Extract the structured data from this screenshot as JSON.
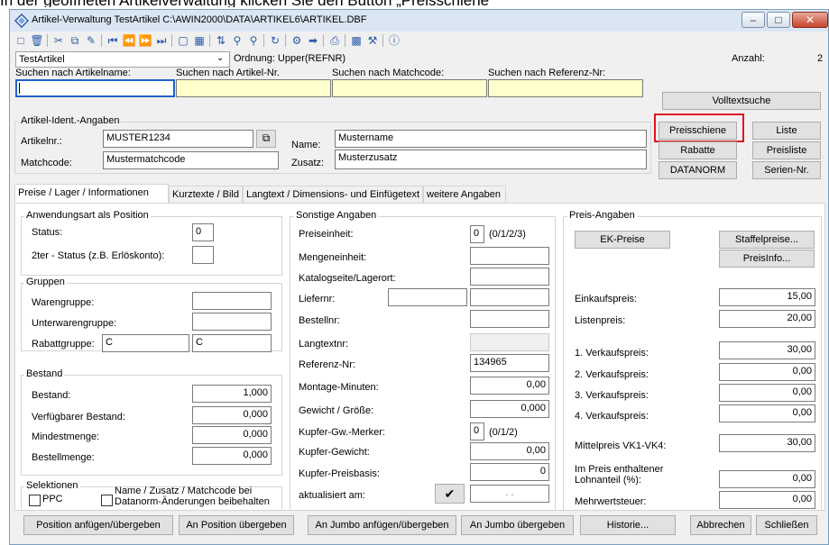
{
  "caption": "In der geöffneten Artikelverwaltung klicken Sie den Button „Preisschiene“",
  "window": {
    "title": "Artikel-Verwaltung   TestArtikel   C:\\AWIN2000\\DATA\\ARTIKEL6\\ARTIKEL.DBF",
    "minimize": "–",
    "maximize": "□",
    "close": "✕"
  },
  "toolbar_icons": [
    "new-doc-icon",
    "delete-icon",
    "cut-icon",
    "copy-icon",
    "paste-icon",
    "first-record-icon",
    "prev-page-icon",
    "next-page-icon",
    "last-record-icon",
    "form-view-icon",
    "table-view-icon",
    "sort-icon",
    "search-icon",
    "search-next-icon",
    "refresh-icon",
    "filter-icon",
    "goto-icon",
    "print-icon",
    "report-icon",
    "settings-icon",
    "info-icon"
  ],
  "search": {
    "table_name": "TestArtikel",
    "ordnung": "Ordnung: Upper(REFNR)",
    "anzahl_label": "Anzahl:",
    "anzahl_value": "2",
    "labels": [
      "Suchen nach Artikelname:",
      "Suchen nach Artikel-Nr.",
      "Suchen nach Matchcode:",
      "Suchen nach Referenz-Nr:"
    ],
    "volltext": "Volltextsuche"
  },
  "ident": {
    "group": "Artikel-Ident.-Angaben",
    "artikelnr_label": "Artikelnr.:",
    "artikelnr": "MUSTER1234",
    "matchcode_label": "Matchcode:",
    "matchcode": "Mustermatchcode",
    "name_label": "Name:",
    "name": "Mustername",
    "zusatz_label": "Zusatz:",
    "zusatz": "Musterzusatz"
  },
  "side_buttons": {
    "preisschiene": "Preisschiene",
    "liste": "Liste",
    "rabatte": "Rabatte",
    "preisliste": "Preisliste",
    "datanorm": "DATANORM",
    "seriennr": "Serien-Nr."
  },
  "tabs": [
    "Preise / Lager / Informationen",
    "Kurztexte / Bild",
    "Langtext / Dimensions- und Einfügetext",
    "weitere Angaben"
  ],
  "anwendung": {
    "group": "Anwendungsart als Position",
    "status_label": "Status:",
    "status": "0",
    "status2_label": "2ter - Status (z.B. Erlöskonto):",
    "status2": ""
  },
  "gruppen": {
    "group": "Gruppen",
    "warengruppe_label": "Warengruppe:",
    "unterwarengruppe_label": "Unterwarengruppe:",
    "rabattgruppe_label": "Rabattgruppe:",
    "rabattgruppe_a": "C",
    "rabattgruppe_b": "C"
  },
  "bestand": {
    "group": "Bestand",
    "rows": [
      {
        "label": "Bestand:",
        "value": "1,000"
      },
      {
        "label": "Verfügbarer Bestand:",
        "value": "0,000"
      },
      {
        "label": "Mindestmenge:",
        "value": "0,000"
      },
      {
        "label": "Bestellmenge:",
        "value": "0,000"
      }
    ]
  },
  "selektionen": {
    "group": "Selektionen",
    "ppc": "PPC",
    "name_zusatz": "Name / Zusatz / Matchcode bei",
    "name_zusatz2": "Datanorm-Änderungen beibehalten"
  },
  "sonstige": {
    "group": "Sonstige Angaben",
    "preiseinheit_label": "Preiseinheit:",
    "preiseinheit": "0",
    "preiseinheit_hint": "(0/1/2/3)",
    "mengeneinheit_label": "Mengeneinheit:",
    "katalog_label": "Katalogseite/Lagerort:",
    "liefernr_label": "Liefernr:",
    "bestellnr_label": "Bestellnr:",
    "langtextnr_label": "Langtextnr:",
    "referenz_label": "Referenz-Nr:",
    "referenz": "134965",
    "montage_label": "Montage-Minuten:",
    "montage": "0,00",
    "gewicht_label": "Gewicht / Größe:",
    "gewicht": "0,000",
    "kupfer_merker_label": "Kupfer-Gw.-Merker:",
    "kupfer_merker": "0",
    "kupfer_merker_hint": "(0/1/2)",
    "kupfer_gewicht_label": "Kupfer-Gewicht:",
    "kupfer_gewicht": "0,00",
    "kupfer_preisbasis_label": "Kupfer-Preisbasis:",
    "kupfer_preisbasis": "0",
    "aktualisiert_label": "aktualisiert am:",
    "check": "✔",
    "aktualisiert": ". ."
  },
  "preis": {
    "group": "Preis-Angaben",
    "ek_preise": "EK-Preise",
    "staffelpreise": "Staffelpreise...",
    "preisinfo": "PreisInfo...",
    "rows": [
      {
        "label": "Einkaufspreis:",
        "value": "15,00"
      },
      {
        "label": "Listenpreis:",
        "value": "20,00"
      },
      {
        "label": "1. Verkaufspreis:",
        "value": "30,00"
      },
      {
        "label": "2. Verkaufspreis:",
        "value": "0,00"
      },
      {
        "label": "3. Verkaufspreis:",
        "value": "0,00"
      },
      {
        "label": "4. Verkaufspreis:",
        "value": "0,00"
      },
      {
        "label": "Mittelpreis VK1-VK4:",
        "value": "30,00"
      }
    ],
    "lohn_label_1": "Im Preis enthaltener",
    "lohn_label_2": "Lohnanteil (%):",
    "lohn": "0,00",
    "mwst_label": "Mehrwertsteuer:",
    "mwst": "0,00"
  },
  "bottom_buttons": [
    "Position anfügen/übergeben",
    "An Position übergeben",
    "An Jumbo anfügen/übergeben",
    "An Jumbo übergeben",
    "Historie...",
    "Abbrechen",
    "Schließen"
  ]
}
